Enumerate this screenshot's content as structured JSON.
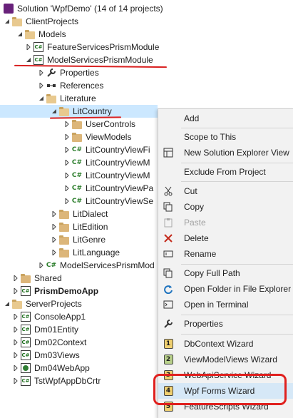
{
  "tree": {
    "solution": "Solution 'WpfDemo' (14 of 14 projects)",
    "client_projects": "ClientProjects",
    "models": "Models",
    "feature_services": "FeatureServicesPrismModule",
    "model_services": "ModelServicesPrismModule",
    "properties": "Properties",
    "references": "References",
    "literature": "Literature",
    "lit_country": "LitCountry",
    "user_controls": "UserControls",
    "view_models": "ViewModels",
    "file1": "LitCountryViewFi",
    "file2": "LitCountryViewM",
    "file3": "LitCountryViewM",
    "file4": "LitCountryViewPa",
    "file5": "LitCountryViewSe",
    "lit_dialect": "LitDialect",
    "lit_edition": "LitEdition",
    "lit_genre": "LitGenre",
    "lit_language": "LitLanguage",
    "model_services_file": "ModelServicesPrismMod",
    "shared": "Shared",
    "prism_demo_app": "PrismDemoApp",
    "server_projects": "ServerProjects",
    "console_app": "ConsoleApp1",
    "dm01": "Dm01Entity",
    "dm02": "Dm02Context",
    "dm03": "Dm03Views",
    "dm04": "Dm04WebApp",
    "tst": "TstWpfAppDbCrtr"
  },
  "menu": {
    "add": "Add",
    "scope": "Scope to This",
    "new_view": "New Solution Explorer View",
    "exclude": "Exclude From Project",
    "cut": "Cut",
    "copy": "Copy",
    "paste": "Paste",
    "delete": "Delete",
    "rename": "Rename",
    "copy_path": "Copy Full Path",
    "open_folder": "Open Folder in File Explorer",
    "open_terminal": "Open in Terminal",
    "properties": "Properties",
    "dbcontext": "DbContext Wizard",
    "viewmodelviews": "ViewModelViews Wizard",
    "webapi": "WebApiService Wizard",
    "wpfforms": "Wpf Forms Wizard",
    "featurescripts": "FeatureScripts Wizard",
    "num1": "1",
    "num2": "2",
    "num3": "3",
    "num4": "4",
    "num5": "5"
  },
  "icons": {
    "cs_label": "C#",
    "folder": "folder-icon",
    "project": "csharp-project-icon",
    "web_project": "web-project-icon",
    "wrench": "wrench-icon",
    "references": "references-icon"
  },
  "colors": {
    "selection": "#cce8ff",
    "menu_highlight": "#d6e8f7",
    "annotation_red": "#e0201e",
    "folder": "#dcb67a",
    "cs_green": "#2a7d2a"
  }
}
